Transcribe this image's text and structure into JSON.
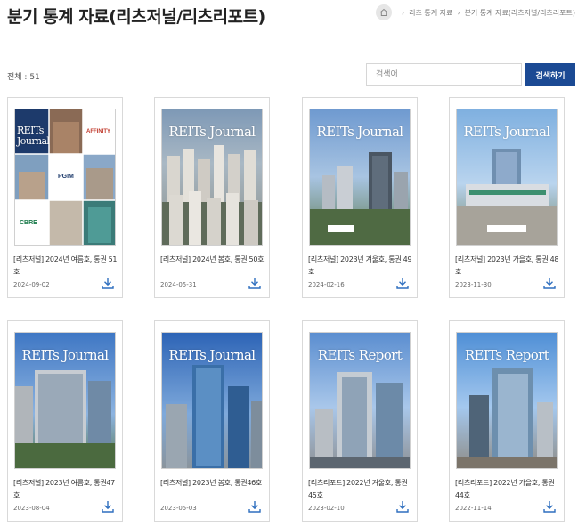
{
  "page_title": "분기 통계 자료(리츠저널/리츠리포트)",
  "breadcrumb": [
    "리츠 통계 자료",
    "분기 통계 자료(리츠저널/리츠리포트)"
  ],
  "total_label": "전체 : 51",
  "search": {
    "placeholder": "검색어",
    "button_label": "검색하기"
  },
  "colors": {
    "accent": "#1b4a94",
    "download_icon": "#2f6fbf"
  },
  "icons": {
    "home": "home-icon",
    "download": "download-icon"
  },
  "cards": [
    {
      "title": "[리츠저널] 2024년 여름호, 통권 51호",
      "date": "2024-09-02",
      "cover_title": "REITs Journal",
      "logos": [
        "AFFINITY",
        "PGIM",
        "CBRE"
      ]
    },
    {
      "title": "[리츠저널] 2024년 봄호, 통권 50호",
      "date": "2024-05-31",
      "cover_title": "REITs Journal"
    },
    {
      "title": "[리츠저널] 2023년 겨울호, 통권 49호",
      "date": "2024-02-16",
      "cover_title": "REITs Journal"
    },
    {
      "title": "[리츠저널] 2023년 가을호, 통권 48호",
      "date": "2023-11-30",
      "cover_title": "REITs Journal"
    },
    {
      "title": "[리츠저널] 2023년 여름호, 통권47호",
      "date": "2023-08-04",
      "cover_title": "REITs Journal"
    },
    {
      "title": "[리츠저널] 2023년 봄호, 통권46호",
      "date": "2023-05-03",
      "cover_title": "REITs Journal"
    },
    {
      "title": "[리츠리포트] 2022년 겨울호, 통권45호",
      "date": "2023-02-10",
      "cover_title": "REITs Report"
    },
    {
      "title": "[리츠리포트] 2022년 가을호, 통권44호",
      "date": "2022-11-14",
      "cover_title": "REITs Report"
    }
  ]
}
